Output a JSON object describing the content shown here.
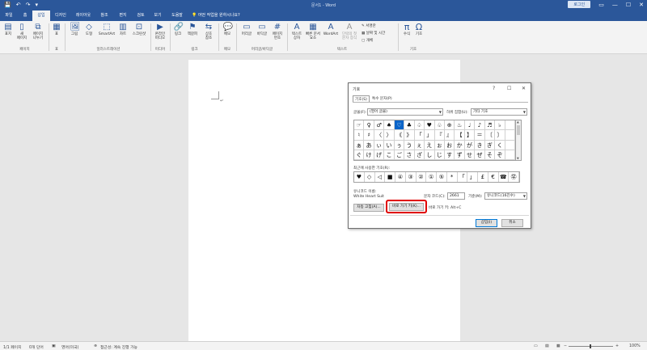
{
  "window": {
    "title": "문서1 - Word",
    "login": "로그인",
    "qat": [
      "💾",
      "↶",
      "↷",
      "▾"
    ],
    "controls": [
      "▭",
      "—",
      "☐",
      "✕"
    ]
  },
  "tabs": [
    {
      "label": "파일"
    },
    {
      "label": "홈"
    },
    {
      "label": "삽입"
    },
    {
      "label": "디자인"
    },
    {
      "label": "레이아웃"
    },
    {
      "label": "참조"
    },
    {
      "label": "편지"
    },
    {
      "label": "검토"
    },
    {
      "label": "보기"
    },
    {
      "label": "도움말"
    }
  ],
  "search": {
    "icon": "lightbulb-icon",
    "text": "어떤 작업을 원하시나요?"
  },
  "ribbon": {
    "buttons": [
      {
        "label": "표지",
        "icon": "▤"
      },
      {
        "label": "새\n페이지",
        "icon": "▯"
      },
      {
        "label": "페이지\n나누기",
        "icon": "⧉"
      },
      {
        "label": "표",
        "icon": "▦"
      },
      {
        "label": "그림",
        "icon": "🖼"
      },
      {
        "label": "도형",
        "icon": "◇"
      },
      {
        "label": "SmartArt",
        "icon": "⬚"
      },
      {
        "label": "차트",
        "icon": "▥"
      },
      {
        "label": "스크린샷",
        "icon": "⊡"
      },
      {
        "label": "온라인\n비디오",
        "icon": "▶"
      },
      {
        "label": "링크",
        "icon": "🔗"
      },
      {
        "label": "책갈피",
        "icon": "⚑"
      },
      {
        "label": "상호\n참조",
        "icon": "⇆"
      },
      {
        "label": "메모",
        "icon": "💬"
      },
      {
        "label": "머리글",
        "icon": "▭"
      },
      {
        "label": "바닥글",
        "icon": "▭"
      },
      {
        "label": "페이지\n번호",
        "icon": "#"
      },
      {
        "label": "텍스트\n상자",
        "icon": "A"
      },
      {
        "label": "빠른 문서\n요소",
        "icon": "▦"
      },
      {
        "label": "WordArt",
        "icon": "A"
      },
      {
        "label": "단락의 첫\n문자 장식",
        "icon": "A"
      },
      {
        "label": "수식",
        "icon": "π"
      },
      {
        "label": "기호",
        "icon": "Ω"
      }
    ],
    "small": [
      "서명란",
      "날짜 및 시간",
      "개체"
    ],
    "groups": [
      "페이지",
      "표",
      "일러스트레이션",
      "미디어",
      "링크",
      "메모",
      "머리글/바닥글",
      "텍스트",
      "기호"
    ]
  },
  "dialog": {
    "title": "기호",
    "controls": [
      "?",
      "☐",
      "✕"
    ],
    "tabs": [
      "기호(S)",
      "특수 문자(P)"
    ],
    "font_label": "글꼴(F):",
    "font_value": "(영어 글꼴)",
    "subset_label": "하위 집합(U):",
    "subset_value": "기타 기호",
    "grid": [
      [
        "☞",
        "♀",
        "♂",
        "♠",
        "♡",
        "♣",
        "♤",
        "♥",
        "♧",
        "⊕",
        "♨",
        "♩",
        "♪",
        "♬",
        "♭",
        ""
      ],
      [
        "♮",
        "♯",
        "〈",
        "〉",
        "《",
        "》",
        "「",
        "」",
        "『",
        "』",
        "【",
        "】",
        "＝",
        "〔",
        "〕",
        ""
      ],
      [
        "ぁ",
        "あ",
        "ぃ",
        "い",
        "ぅ",
        "う",
        "ぇ",
        "え",
        "ぉ",
        "お",
        "か",
        "が",
        "き",
        "ぎ",
        "く",
        ""
      ],
      [
        "ぐ",
        "け",
        "げ",
        "こ",
        "ご",
        "さ",
        "ざ",
        "し",
        "じ",
        "す",
        "ず",
        "せ",
        "ぜ",
        "そ",
        "ぞ",
        ""
      ]
    ],
    "recent_label": "최근에 사용한 기호(R):",
    "recent": [
      "♥",
      "◇",
      "◁",
      "■",
      "④",
      "③",
      "②",
      "①",
      "⑤",
      "*",
      "「",
      "」",
      "£",
      "€",
      "☎",
      "㉾"
    ],
    "unicode_name_label": "유니코드 이름:",
    "unicode_name": "White Heart Suit",
    "char_code_label": "문자 코드(C):",
    "char_code": "2661",
    "from_label": "기준(M):",
    "from_value": "유니코드(16진수)",
    "autocorrect_btn": "자동 고침(A)...",
    "shortcut_btn": "바로 가기 키(K)...",
    "shortcut_text": "바로 가기 키: Alt+C",
    "insert_btn": "삽입(I)",
    "cancel_btn": "취소"
  },
  "status": {
    "page": "1/1 페이지",
    "words": "0개 단어",
    "lang": "영어(미국)",
    "accessibility": "접근성: 계속 진행 가능",
    "zoom": "100%"
  }
}
